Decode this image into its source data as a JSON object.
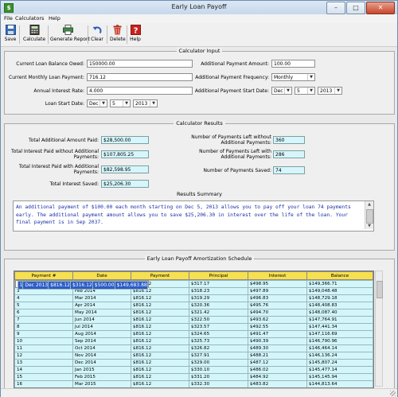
{
  "window": {
    "title": "Early Loan Payoff",
    "minimize": "–",
    "maximize": "□",
    "close": "✕"
  },
  "menu": [
    "File",
    "Calculators",
    "Help"
  ],
  "toolbar": {
    "save": "Save",
    "calculate": "Calculate",
    "generate_report": "Generate Report",
    "clear": "Clear",
    "delete": "Delete",
    "help": "Help"
  },
  "calc_input": {
    "title": "Calculator Input",
    "balance_label": "Current Loan Balance Owed:",
    "balance_value": "150000.00",
    "monthly_label": "Current Monthly Loan Payment:",
    "monthly_value": "716.12",
    "rate_label": "Annual Interest Rate:",
    "rate_value": "4.000",
    "start_label": "Loan Start Date:",
    "start_month": "Dec",
    "start_day": "5",
    "start_year": "2013",
    "add_amount_label": "Additional Payment Amount:",
    "add_amount_value": "100.00",
    "freq_label": "Additional Payment Frequency:",
    "freq_value": "Monthly",
    "add_start_label": "Additional Payment Start Date:",
    "add_start_month": "Dec",
    "add_start_day": "5",
    "add_start_year": "2013"
  },
  "calc_results": {
    "title": "Calculator Results",
    "total_add_label": "Total Additional Amount Paid:",
    "total_add_value": "$28,500.00",
    "int_without_label": "Total Interest Paid without Additional Payments:",
    "int_without_value": "$107,805.25",
    "int_with_label": "Total Interest Paid with Additional Payments:",
    "int_with_value": "$82,598.95",
    "int_saved_label": "Total Interest Saved:",
    "int_saved_value": "$25,206.30",
    "left_without_label": "Number of Payments Left without Additional Payments:",
    "left_without_value": "360",
    "left_with_label": "Number of Payments Left with Additional Payments:",
    "left_with_value": "286",
    "saved_label": "Number of Payments Saved:",
    "saved_value": "74"
  },
  "summary": {
    "title": "Results Summary",
    "text": "An additional payment of $100.00 each month starting on Dec 5, 2013 allows you to pay off your loan 74 payments early. The additional payment amount allows you to save $25,206.30 in interest over the life of the loan. Your final payment is in Sep 2037."
  },
  "schedule": {
    "title": "Early Loan Payoff Amortization Schedule",
    "columns": [
      "Payment #",
      "Date",
      "Payment",
      "Principal",
      "Interest",
      "Balance"
    ],
    "rows": [
      [
        "1",
        "Dec 2013",
        "$816.12",
        "$316.12",
        "$500.00",
        "$149,683.88"
      ],
      [
        "2",
        "Jan 2014",
        "$816.12",
        "$317.17",
        "$498.95",
        "$149,366.71"
      ],
      [
        "3",
        "Feb 2014",
        "$816.12",
        "$318.23",
        "$497.89",
        "$149,048.48"
      ],
      [
        "4",
        "Mar 2014",
        "$816.12",
        "$319.29",
        "$496.83",
        "$148,729.18"
      ],
      [
        "5",
        "Apr 2014",
        "$816.12",
        "$320.36",
        "$495.76",
        "$148,408.83"
      ],
      [
        "6",
        "May 2014",
        "$816.12",
        "$321.42",
        "$494.70",
        "$148,087.40"
      ],
      [
        "7",
        "Jun 2014",
        "$816.12",
        "$322.50",
        "$493.62",
        "$147,764.91"
      ],
      [
        "8",
        "Jul 2014",
        "$816.12",
        "$323.57",
        "$492.55",
        "$147,441.34"
      ],
      [
        "9",
        "Aug 2014",
        "$816.12",
        "$324.65",
        "$491.47",
        "$147,116.69"
      ],
      [
        "10",
        "Sep 2014",
        "$816.12",
        "$325.73",
        "$490.39",
        "$146,790.96"
      ],
      [
        "11",
        "Oct 2014",
        "$816.12",
        "$326.82",
        "$489.30",
        "$146,464.14"
      ],
      [
        "12",
        "Nov 2014",
        "$816.12",
        "$327.91",
        "$488.21",
        "$146,136.24"
      ],
      [
        "13",
        "Dec 2014",
        "$816.12",
        "$329.00",
        "$487.12",
        "$145,807.24"
      ],
      [
        "14",
        "Jan 2015",
        "$816.12",
        "$330.10",
        "$486.02",
        "$145,477.14"
      ],
      [
        "15",
        "Feb 2015",
        "$816.12",
        "$331.20",
        "$484.92",
        "$145,145.94"
      ],
      [
        "16",
        "Mar 2015",
        "$816.12",
        "$332.30",
        "$483.82",
        "$144,813.64"
      ]
    ]
  }
}
